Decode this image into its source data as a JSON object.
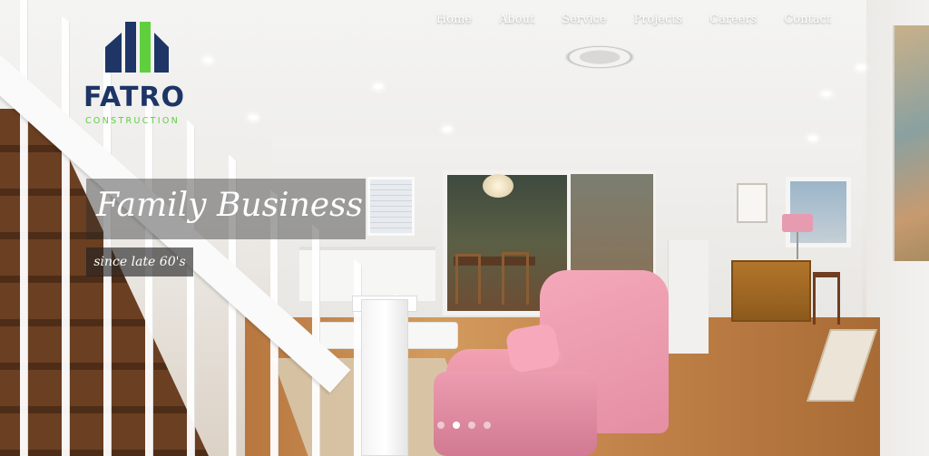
{
  "brand": {
    "name": "FATRO",
    "tagline": "CONSTRUCTION",
    "colors": {
      "navy": "#1e3566",
      "green": "#5fcf3d"
    }
  },
  "nav": {
    "items": [
      {
        "label": "Home"
      },
      {
        "label": "About"
      },
      {
        "label": "Service"
      },
      {
        "label": "Projects"
      },
      {
        "label": "Careers"
      },
      {
        "label": "Contact"
      }
    ]
  },
  "slider": {
    "title": "Family Business",
    "subtitle": "since late 60's",
    "slide_count": 4,
    "active_index": 2
  }
}
